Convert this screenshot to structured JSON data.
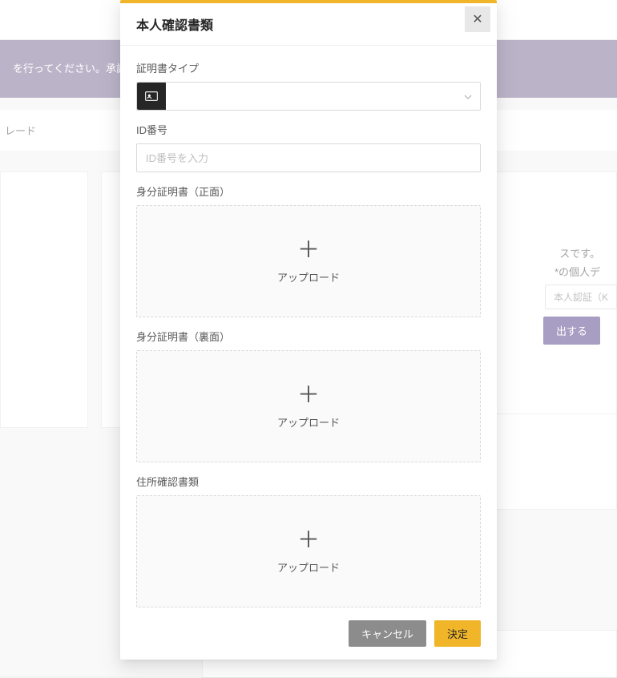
{
  "modal": {
    "title": "本人確認書類",
    "labels": {
      "cert_type": "証明書タイプ",
      "id_number": "ID番号",
      "id_front": "身分証明書（正面）",
      "id_back": "身分証明書（裏面）",
      "address_proof": "住所確認書類"
    },
    "id_number_placeholder": "ID番号を入力",
    "upload_text": "アップロード",
    "buttons": {
      "cancel": "キャンセル",
      "ok": "決定"
    }
  },
  "background": {
    "notice_text": "を行ってください。承認が",
    "sub_text": "レード",
    "right_text_line1": "スです。",
    "right_text_line2": "*の個人デ",
    "kyc_button": "本人認証（K",
    "submit_button": "出する"
  }
}
